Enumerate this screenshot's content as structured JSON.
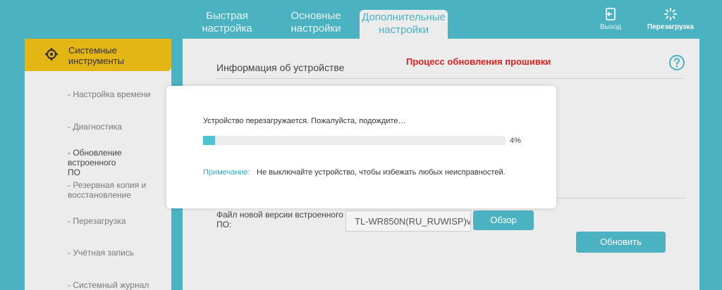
{
  "header": {
    "tabs": [
      {
        "label_line1": "Быстрая",
        "label_line2": "настройка",
        "active": false
      },
      {
        "label_line1": "Основные",
        "label_line2": "настройки",
        "active": false
      },
      {
        "label_line1": "Дополнительные",
        "label_line2": "настройки",
        "active": true
      }
    ],
    "logout_label": "Выход",
    "reboot_label": "Перезагрузка"
  },
  "sidebar": {
    "section_title_line1": "Системные",
    "section_title_line2": "инструменты",
    "items": [
      {
        "line1": "- Настройка времени",
        "line2": ""
      },
      {
        "line1": "- Диагностика",
        "line2": ""
      },
      {
        "line1": "- Обновление встроенного",
        "line2": "ПО"
      },
      {
        "line1": "- Резервная копия и",
        "line2": "восстановление"
      },
      {
        "line1": "- Перезагрузка",
        "line2": ""
      },
      {
        "line1": "- Учётная запись",
        "line2": ""
      },
      {
        "line1": "- Системный журнал",
        "line2": ""
      }
    ]
  },
  "main": {
    "section_title": "Информация об устройстве",
    "annotation": "Процесс обновления прошивки",
    "firmware_label_line1": "Файл новой версии встроенного",
    "firmware_label_line2": "ПО:",
    "firmware_file_value": "TL-WR850N(RU_RUWISP)v",
    "browse_label": "Обзор",
    "update_label": "Обновить"
  },
  "modal": {
    "message": "Устройство перезагружается. Пожалуйста, подождите…",
    "progress_percent": 4,
    "progress_text": "4%",
    "note_label": "Примечание:",
    "note_text": "Не выключайте устройство, чтобы избежать любых неисправностей."
  },
  "colors": {
    "accent": "#4ab2c0",
    "sidebar_active": "#e3b515",
    "annotation": "#e02020"
  }
}
